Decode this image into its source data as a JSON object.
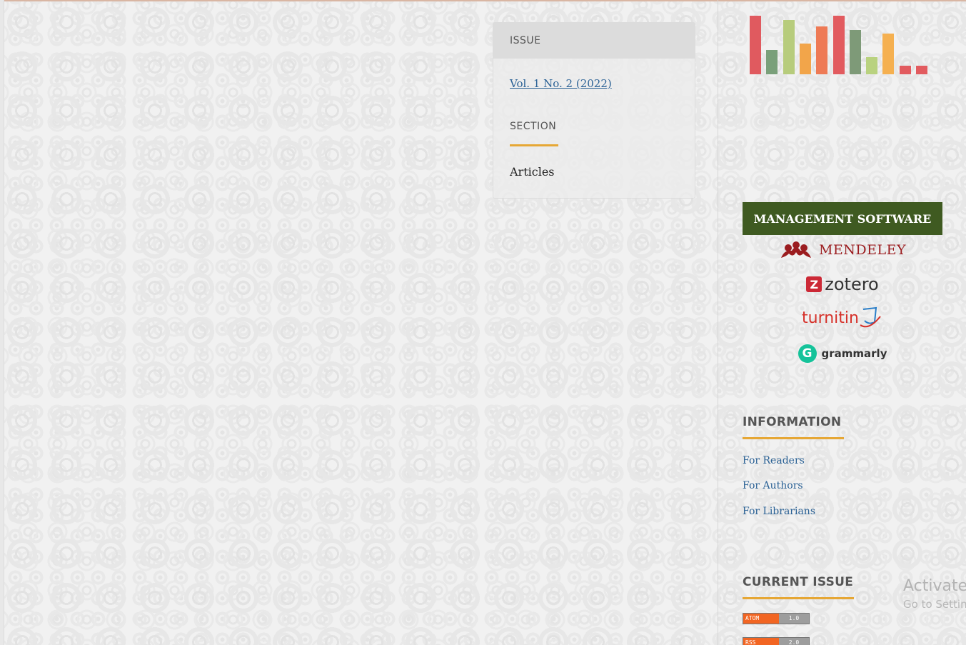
{
  "details": {
    "issue_label": "ISSUE",
    "issue_link": "Vol. 1 No. 2 (2022)",
    "section_label": "SECTION",
    "section_value": "Articles"
  },
  "sidebar": {
    "stats_logo": {
      "icon": "bar-chart-logo",
      "bar_colors": [
        "#e05a5f",
        "#7aa07a",
        "#b7cc7c",
        "#f2a54a",
        "#ee7a55",
        "#e25b5f",
        "#7e9a78",
        "#b9d27f",
        "#f5b050",
        "#e25b5f",
        "#e25b5f"
      ],
      "bar_levels": [
        0.95,
        0.4,
        0.88,
        0.5,
        0.78,
        0.95,
        0.72,
        0.28,
        0.66,
        0.14,
        0.14
      ]
    },
    "management_title": "MANAGEMENT SOFTWARE",
    "tools": {
      "mendeley": "MENDELEY",
      "zotero": "zotero",
      "zotero_mark": "Z",
      "turnitin": "turnitin",
      "grammarly": "grammarly",
      "grammarly_mark": "G"
    },
    "information": {
      "title": "INFORMATION",
      "links": [
        "For Readers",
        "For Authors",
        "For Librarians"
      ]
    },
    "current_issue": {
      "title": "CURRENT ISSUE",
      "atom": {
        "left": "ATOM",
        "right": "1.0"
      },
      "rss": {
        "left": "RSS",
        "right": "2.0"
      }
    }
  },
  "windows_overlay": {
    "line1": "Activate",
    "line2": "Go to Settin"
  },
  "colors": {
    "accent": "#e6a735",
    "link": "#2a6195",
    "management_bg": "#3f5a21"
  }
}
